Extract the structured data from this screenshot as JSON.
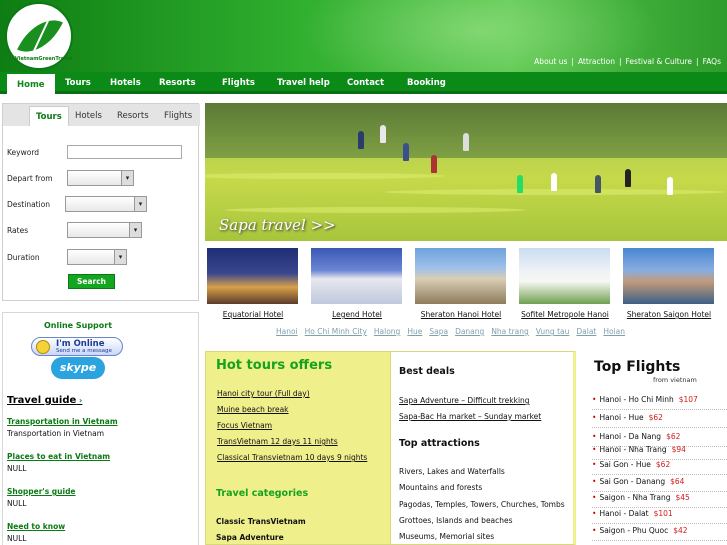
{
  "header": {
    "logo_text": "VietnamGreenTravel",
    "top_links": [
      "About us",
      "Attraction",
      "Festival & Culture",
      "FAQs"
    ]
  },
  "nav": [
    "Home",
    "Tours",
    "Hotels",
    "Resorts",
    "Flights",
    "Travel help",
    "Contact",
    "Booking"
  ],
  "search": {
    "tabs": [
      "Tours",
      "Hotels",
      "Resorts",
      "Flights"
    ],
    "fields": [
      "Keyword",
      "Depart from",
      "Destination",
      "Rates",
      "Duration"
    ],
    "button": "Search"
  },
  "support": {
    "title": "Online Support",
    "im_online": "I'm Online",
    "im_sub": "Send me a message",
    "skype": "skype"
  },
  "guide": {
    "title": "Travel guide",
    "sections": [
      {
        "link": "Transportation in Vietnam",
        "text": "Transportation in Vietnam"
      },
      {
        "link": "Places to eat in Vietnam",
        "text": "NULL"
      },
      {
        "link": "Shopper's guide",
        "text": "NULL"
      },
      {
        "link": "Need to know",
        "text": "NULL"
      }
    ]
  },
  "banner": {
    "caption": "Sapa travel >>"
  },
  "hotels": [
    "Equatorial Hotel",
    "Legend Hotel",
    "Sheraton Hanoi Hotel",
    "Sofitel Metropole Hanoi",
    "Sheraton Saigon Hotel"
  ],
  "cities": [
    "Hanoi",
    "Ho Chi Minh City",
    "Halong",
    "Hue",
    "Sapa",
    "Danang",
    "Nha trang",
    "Vung tau",
    "Dalat",
    "Hoian"
  ],
  "hot_tours": {
    "title": "Hot tours offers",
    "items": [
      "Hanoi city tour (Full day)",
      "Muine beach break",
      "Focus Vietnam",
      "TransVietnam 12 days 11 nights",
      "Classical Transvietnam 10 days 9 nights"
    ],
    "categories_title": "Travel categories",
    "categories": [
      "Classic TransVietnam",
      "Sapa Adventure"
    ]
  },
  "deals": {
    "title": "Best deals",
    "items": [
      "Sapa Adventure – Difficult trekking",
      "Sapa-Bac Ha market – Sunday market"
    ],
    "attractions_title": "Top attractions",
    "attractions": [
      "Rivers, Lakes and Waterfalls",
      "Mountains and forests",
      "Pagodas, Temples, Towers, Churches, Tombs",
      "Grottoes, Islands and beaches",
      "Museums, Memorial sites"
    ]
  },
  "flights": {
    "title": "Top Flights",
    "subtitle": "from vietnam",
    "items": [
      {
        "route": "Hanoi - Ho Chi Minh",
        "price": "$107"
      },
      {
        "route": "Hanoi - Hue",
        "price": "$62"
      },
      {
        "route": "Hanoi - Da Nang",
        "price": "$62"
      },
      {
        "route": "Hanoi - Nha Trang",
        "price": "$94"
      },
      {
        "route": "Sai Gon - Hue",
        "price": "$62"
      },
      {
        "route": "Sai Gon - Danang",
        "price": "$64"
      },
      {
        "route": "Saigon - Nha Trang",
        "price": "$45"
      },
      {
        "route": "Hanoi - Dalat",
        "price": "$101"
      },
      {
        "route": "Saigon - Phu Quoc",
        "price": "$42"
      }
    ]
  }
}
